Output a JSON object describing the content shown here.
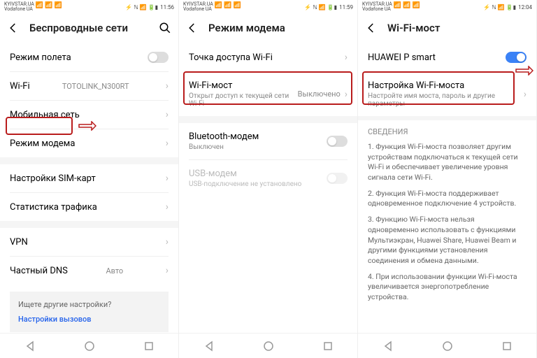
{
  "phones": [
    {
      "status": {
        "carrier1": "KYIVSTAR.UA",
        "carrier2": "Vodafone UA",
        "time": "11:56"
      },
      "title": "Беспроводные сети",
      "rows": {
        "airplane": "Режим полета",
        "wifi": "Wi-Fi",
        "wifi_val": "TOTOLINK_N300RT",
        "mobile": "Мобильная сеть",
        "tether": "Режим модема",
        "sim": "Настройки SIM-карт",
        "stats": "Статистика трафика",
        "vpn": "VPN",
        "dns": "Частный DNS",
        "dns_val": "Авто"
      },
      "hint_q": "Ищете другие настройки?",
      "hint_link": "Настройки вызовов"
    },
    {
      "status": {
        "carrier1": "KYIVSTAR.UA",
        "carrier2": "Vodafone UA",
        "time": "11:59"
      },
      "title": "Режим модема",
      "rows": {
        "hotspot": "Точка доступа Wi-Fi",
        "bridge": "Wi-Fi-мост",
        "bridge_sub": "Открыт доступ к текущей сети Wi-Fi",
        "bridge_val": "Выключено",
        "bt": "Bluetooth-модем",
        "bt_sub": "Выключен",
        "usb": "USB-модем",
        "usb_sub": "USB-подключение не установлено"
      }
    },
    {
      "status": {
        "carrier1": "KYIVSTAR.UA",
        "carrier2": "Vodafone UA",
        "time": "12:04"
      },
      "title": "Wi-Fi-мост",
      "rows": {
        "device": "HUAWEI P smart",
        "cfg": "Настройка Wi-Fi-моста",
        "cfg_sub": "Настройте имя моста, пароль и другие параметры"
      },
      "section": "СВЕДЕНИЯ",
      "info1": "1. Функция Wi-Fi-моста позволяет другим устройствам подключаться к текущей сети Wi-Fi и обеспечивает увеличение уровня сигнала сети Wi-Fi.",
      "info2": "2. Функция Wi-Fi-моста поддерживает одновременное подключение 4 устройств.",
      "info3": "3. Функцию Wi-Fi-моста нельзя одновременно использовать с функциями Мультиэкран, Huawei Share, Huawei Beam и другими функциями установления соединения и обмена данными.",
      "info4": "4. При использовании функции Wi-Fi-моста увеличивается энергопотребление устройства."
    }
  ]
}
